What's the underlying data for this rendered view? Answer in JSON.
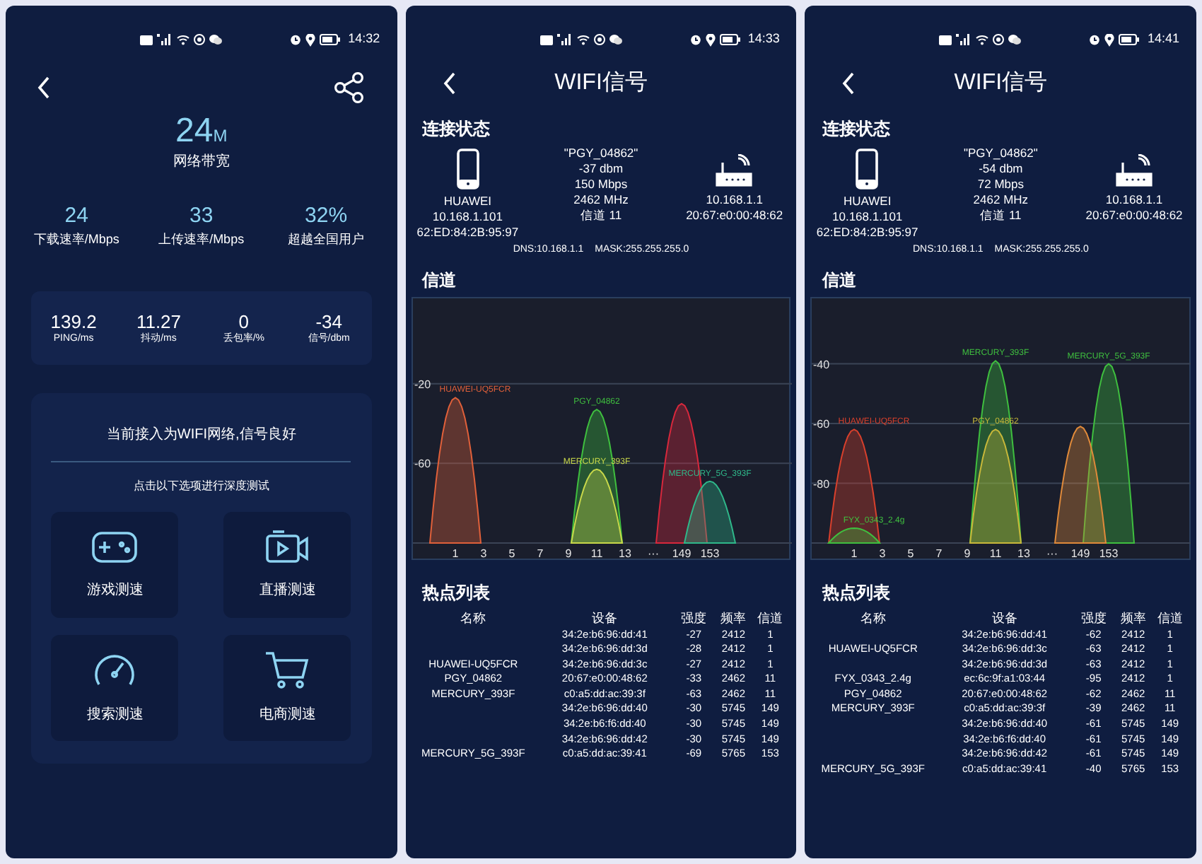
{
  "screens": [
    {
      "kind": "speed",
      "status_bar": {
        "time": "14:32"
      },
      "bandwidth": {
        "value": "24",
        "unit": "M",
        "label": "网络带宽"
      },
      "stats": [
        {
          "value": "24",
          "label": "下载速率/Mbps"
        },
        {
          "value": "33",
          "label": "上传速率/Mbps"
        },
        {
          "value": "32%",
          "label": "超越全国用户"
        }
      ],
      "metrics": [
        {
          "value": "139.2",
          "label": "PING/ms"
        },
        {
          "value": "11.27",
          "label": "抖动/ms"
        },
        {
          "value": "0",
          "label": "丢包率/%"
        },
        {
          "value": "-34",
          "label": "信号/dbm"
        }
      ],
      "status_message": "当前接入为WIFI网络,信号良好",
      "prompt": "点击以下选项进行深度测试",
      "tests": [
        {
          "label": "游戏测速"
        },
        {
          "label": "直播测速"
        },
        {
          "label": "搜索测速"
        },
        {
          "label": "电商测速"
        }
      ]
    },
    {
      "kind": "wifi",
      "status_bar": {
        "time": "14:33"
      },
      "title": "WIFI信号",
      "connection": {
        "heading": "连接状态",
        "device": [
          "HUAWEI",
          "10.168.1.101",
          "62:ED:84:2B:95:97"
        ],
        "network": [
          "\"PGY_04862\"",
          "-37 dbm",
          "150 Mbps",
          "2462 MHz",
          "信道 11"
        ],
        "router": [
          "10.168.1.1",
          "20:67:e0:00:48:62"
        ],
        "dns": "DNS:10.168.1.1",
        "mask": "MASK:255.255.255.0"
      },
      "channel_heading": "信道",
      "channel_chart": {
        "y_labels": [
          "-20",
          "-60"
        ],
        "x_labels": [
          "1",
          "3",
          "5",
          "7",
          "9",
          "11",
          "13",
          "···",
          "149",
          "153"
        ],
        "curves": [
          {
            "label": "HUAWEI-UQ5FCR",
            "color": "#e0603a"
          },
          {
            "label": "PGY_04862",
            "color": "#3fbf3f"
          },
          {
            "label": "MERCURY_393F",
            "color": "#c8d84a"
          },
          {
            "color": "#d8283c"
          },
          {
            "label": "MERCURY_5G_393F",
            "color": "#2fb88a"
          }
        ]
      },
      "hotspot_heading": "热点列表",
      "table": {
        "columns": [
          "名称",
          "设备",
          "强度",
          "频率",
          "信道"
        ],
        "rows": [
          {
            "device": "34:2e:b6:96:dd:41",
            "strength": "-27",
            "frequency": "2412",
            "channel": "1"
          },
          {
            "device": "34:2e:b6:96:dd:3d",
            "strength": "-28",
            "frequency": "2412",
            "channel": "1"
          },
          {
            "name": "HUAWEI-UQ5FCR",
            "device": "34:2e:b6:96:dd:3c",
            "strength": "-27",
            "frequency": "2412",
            "channel": "1"
          },
          {
            "name": "PGY_04862",
            "device": "20:67:e0:00:48:62",
            "strength": "-33",
            "frequency": "2462",
            "channel": "11"
          },
          {
            "name": "MERCURY_393F",
            "device": "c0:a5:dd:ac:39:3f",
            "strength": "-63",
            "frequency": "2462",
            "channel": "11"
          },
          {
            "device": "34:2e:b6:96:dd:40",
            "strength": "-30",
            "frequency": "5745",
            "channel": "149"
          },
          {
            "device": "34:2e:b6:f6:dd:40",
            "strength": "-30",
            "frequency": "5745",
            "channel": "149"
          },
          {
            "device": "34:2e:b6:96:dd:42",
            "strength": "-30",
            "frequency": "5745",
            "channel": "149"
          },
          {
            "name": "MERCURY_5G_393F",
            "device": "c0:a5:dd:ac:39:41",
            "strength": "-69",
            "frequency": "5765",
            "channel": "153"
          }
        ]
      }
    },
    {
      "kind": "wifi",
      "status_bar": {
        "time": "14:41"
      },
      "title": "WIFI信号",
      "connection": {
        "heading": "连接状态",
        "device": [
          "HUAWEI",
          "10.168.1.101",
          "62:ED:84:2B:95:97"
        ],
        "network": [
          "\"PGY_04862\"",
          "-54 dbm",
          "72 Mbps",
          "2462 MHz",
          "信道 11"
        ],
        "router": [
          "10.168.1.1",
          "20:67:e0:00:48:62"
        ],
        "dns": "DNS:10.168.1.1",
        "mask": "MASK:255.255.255.0"
      },
      "channel_heading": "信道",
      "channel_chart": {
        "y_labels": [
          "-40",
          "-60",
          "-80"
        ],
        "x_labels": [
          "1",
          "3",
          "5",
          "7",
          "9",
          "11",
          "13",
          "···",
          "149",
          "153"
        ],
        "curves": [
          {
            "label": "HUAWEI-UQ5FCR",
            "color": "#d8402c"
          },
          {
            "label": "FYX_0343_2.4g",
            "color": "#3fbf3f"
          },
          {
            "label": "PGY_04862",
            "color": "#c8b83a"
          },
          {
            "label": "MERCURY_393F",
            "color": "#3fbf3f"
          },
          {
            "color": "#e08a3a"
          },
          {
            "label": "MERCURY_5G_393F",
            "color": "#3fbf3f"
          }
        ]
      },
      "hotspot_heading": "热点列表",
      "table": {
        "columns": [
          "名称",
          "设备",
          "强度",
          "频率",
          "信道"
        ],
        "rows": [
          {
            "device": "34:2e:b6:96:dd:41",
            "strength": "-62",
            "frequency": "2412",
            "channel": "1"
          },
          {
            "name": "HUAWEI-UQ5FCR",
            "device": "34:2e:b6:96:dd:3c",
            "strength": "-63",
            "frequency": "2412",
            "channel": "1"
          },
          {
            "device": "34:2e:b6:96:dd:3d",
            "strength": "-63",
            "frequency": "2412",
            "channel": "1"
          },
          {
            "name": "FYX_0343_2.4g",
            "device": "ec:6c:9f:a1:03:44",
            "strength": "-95",
            "frequency": "2412",
            "channel": "1"
          },
          {
            "name": "PGY_04862",
            "device": "20:67:e0:00:48:62",
            "strength": "-62",
            "frequency": "2462",
            "channel": "11"
          },
          {
            "name": "MERCURY_393F",
            "device": "c0:a5:dd:ac:39:3f",
            "strength": "-39",
            "frequency": "2462",
            "channel": "11"
          },
          {
            "device": "34:2e:b6:96:dd:40",
            "strength": "-61",
            "frequency": "5745",
            "channel": "149"
          },
          {
            "device": "34:2e:b6:f6:dd:40",
            "strength": "-61",
            "frequency": "5745",
            "channel": "149"
          },
          {
            "device": "34:2e:b6:96:dd:42",
            "strength": "-61",
            "frequency": "5745",
            "channel": "149"
          },
          {
            "name": "MERCURY_5G_393F",
            "device": "c0:a5:dd:ac:39:41",
            "strength": "-40",
            "frequency": "5765",
            "channel": "153"
          }
        ]
      }
    }
  ]
}
